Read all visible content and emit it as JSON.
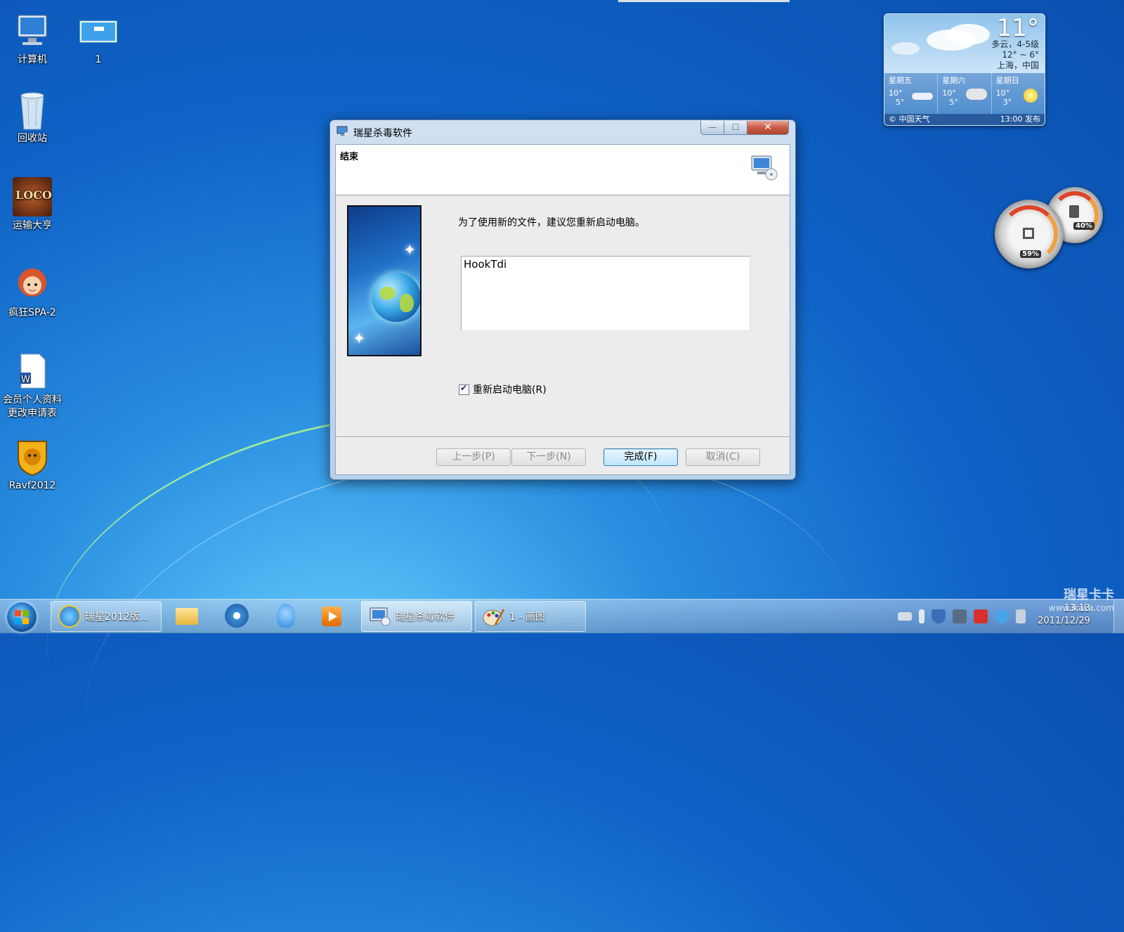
{
  "desktop": {
    "icons": [
      {
        "label": "计算机",
        "icon": "computer-icon"
      },
      {
        "label": "1",
        "icon": "screenshot-file-icon"
      },
      {
        "label": "回收站",
        "icon": "recycle-bin-icon"
      },
      {
        "label": "运输大亨",
        "icon": "loco-game-icon"
      },
      {
        "label": "疯狂SPA-2",
        "icon": "spa-game-icon"
      },
      {
        "label": "会员个人资料更改申请表",
        "label_line1": "会员个人资料",
        "label_line2": "更改申请表",
        "icon": "word-document-icon"
      },
      {
        "label": "Ravf2012",
        "icon": "rising-lion-icon"
      }
    ]
  },
  "weather": {
    "temp": "11°",
    "condition": "多云，4-5级",
    "range": "12° ~ 6°",
    "location": "上海，中国",
    "days": [
      {
        "name": "星期五",
        "hi": "10°",
        "lo": "5°",
        "icon": "wind-cloud-icon"
      },
      {
        "name": "星期六",
        "hi": "10°",
        "lo": "5°",
        "icon": "cloud-icon"
      },
      {
        "name": "星期日",
        "hi": "10°",
        "lo": "3°",
        "icon": "sun-icon"
      }
    ],
    "source": "© 中国天气",
    "published": "13:00 发布"
  },
  "meters": {
    "cpu": "59%",
    "memory": "40%"
  },
  "dialog": {
    "title": "瑞星杀毒软件",
    "header_title": "结束",
    "message": "为了使用新的文件，建议您重新启动电脑。",
    "file_list": [
      "HookTdi"
    ],
    "restart_checkbox": {
      "label": "重新启动电脑(R)",
      "checked": true
    },
    "buttons": {
      "back": "上一步(P)",
      "next": "下一步(N)",
      "finish": "完成(F)",
      "cancel": "取消(C)"
    },
    "window_controls": {
      "minimize": "—",
      "maximize": "☐",
      "close": "✕"
    }
  },
  "taskbar": {
    "items": [
      {
        "label": "瑞星2012版...",
        "icon": "ie-icon"
      },
      {
        "label": "瑞星杀毒软件",
        "icon": "rising-setup-icon"
      },
      {
        "label": "1 - 画图",
        "icon": "paint-icon"
      }
    ],
    "pinned": [
      "explorer-folder-icon",
      "media-center-icon",
      "qq-icon",
      "media-player-icon"
    ],
    "clock_time": "13:13",
    "clock_date": "2011/12/29"
  },
  "watermark": {
    "brand": "瑞星卡卡",
    "url": "www.ikaka.com"
  }
}
